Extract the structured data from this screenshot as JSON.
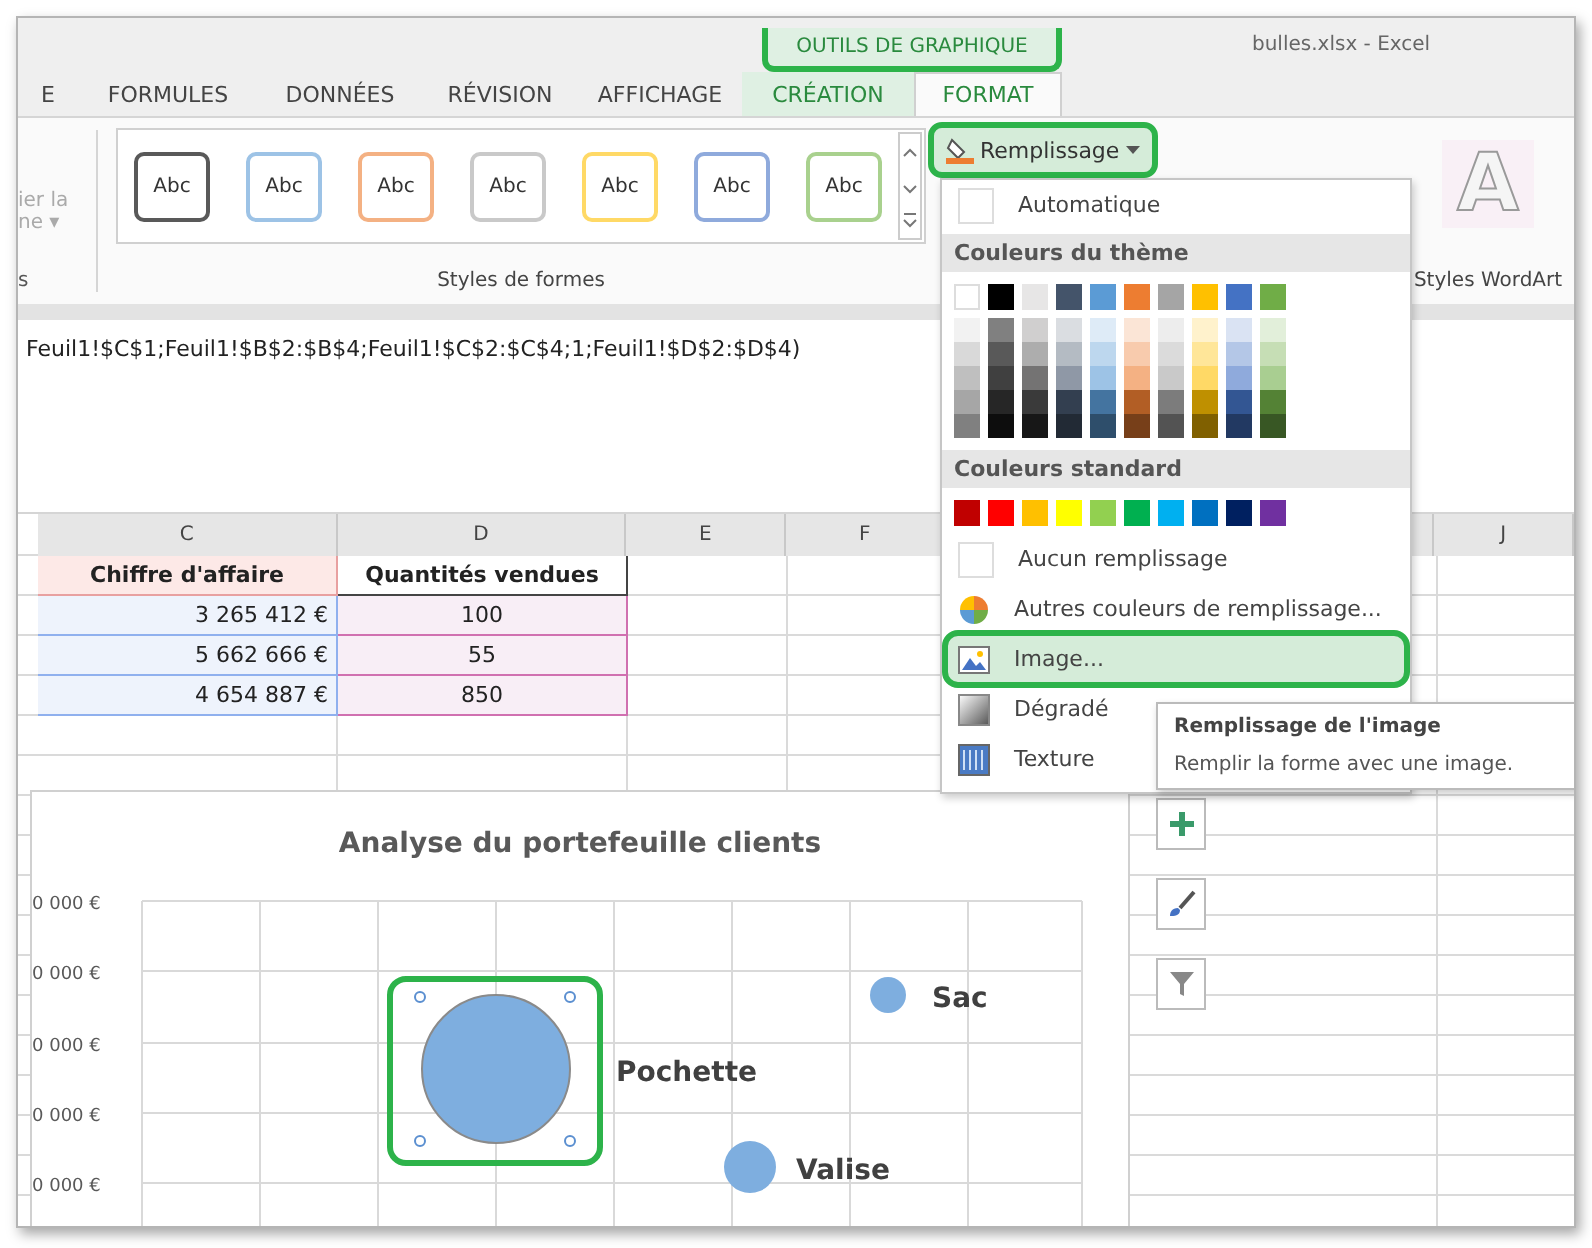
{
  "title_bar": {
    "context_group": {
      "label": "OUTILS DE GRAPHIQUE",
      "highlighted": true
    },
    "title": "bulles.xlsx - Excel"
  },
  "tabs": [
    {
      "label": "E",
      "kind": "normal",
      "selected": false
    },
    {
      "label": "FORMULES",
      "kind": "normal",
      "selected": false
    },
    {
      "label": "DONNÉES",
      "kind": "normal",
      "selected": false
    },
    {
      "label": "RÉVISION",
      "kind": "normal",
      "selected": false
    },
    {
      "label": "AFFICHAGE",
      "kind": "normal",
      "selected": false
    },
    {
      "label": "CRÉATION",
      "kind": "context",
      "selected": false
    },
    {
      "label": "FORMAT",
      "kind": "context",
      "selected": true
    }
  ],
  "ribbon": {
    "left_group": {
      "lines": [
        "ier la",
        "ne ▾"
      ],
      "label": "s",
      "disabled": true
    },
    "shape_styles": {
      "items": [
        {
          "label": "Abc",
          "color": "#595959"
        },
        {
          "label": "Abc",
          "color": "#9dc3e6"
        },
        {
          "label": "Abc",
          "color": "#f4b183"
        },
        {
          "label": "Abc",
          "color": "#c9c9c9"
        },
        {
          "label": "Abc",
          "color": "#ffd966"
        },
        {
          "label": "Abc",
          "color": "#8faadc"
        },
        {
          "label": "Abc",
          "color": "#a9d18e"
        }
      ],
      "label": "Styles de formes"
    },
    "fill_button": {
      "label": "Remplissage",
      "highlighted": true
    },
    "wordart": {
      "letter": "A",
      "label": "Styles WordArt"
    }
  },
  "formula": "Feuil1!$C$1;Feuil1!$B$2:$B$4;Feuil1!$C$2:$C$4;1;Feuil1!$D$2:$D$4)",
  "sheet": {
    "columns": [
      {
        "label": "C"
      },
      {
        "label": "D"
      },
      {
        "label": "E"
      },
      {
        "label": "F"
      },
      {
        "label": "J"
      }
    ],
    "rows": [
      {
        "kind": "header",
        "cells": [
          "Chiffre d'affaire",
          "Quantités vendues"
        ]
      },
      {
        "kind": "data",
        "cells": [
          "3 265 412 €",
          "100"
        ]
      },
      {
        "kind": "data",
        "cells": [
          "5 662 666 €",
          "55"
        ]
      },
      {
        "kind": "data",
        "cells": [
          "4 654 887 €",
          "850"
        ]
      }
    ]
  },
  "fill_menu": {
    "items_top": [
      {
        "label": "Automatique",
        "kind": "blank",
        "selected": false
      }
    ],
    "theme_header": "Couleurs du thème",
    "theme_colors": [
      {
        "color": "#ffffff"
      },
      {
        "color": "#000000"
      },
      {
        "color": "#e7e6e6"
      },
      {
        "color": "#44546a"
      },
      {
        "color": "#5b9bd5"
      },
      {
        "color": "#ed7d31"
      },
      {
        "color": "#a5a5a5"
      },
      {
        "color": "#ffc000"
      },
      {
        "color": "#4472c4"
      },
      {
        "color": "#70ad47"
      }
    ],
    "standard_header": "Couleurs standard",
    "standard_colors": [
      {
        "color": "#c00000"
      },
      {
        "color": "#ff0000"
      },
      {
        "color": "#ffc000"
      },
      {
        "color": "#ffff00"
      },
      {
        "color": "#92d050"
      },
      {
        "color": "#00b050"
      },
      {
        "color": "#00b0f0"
      },
      {
        "color": "#0070c0"
      },
      {
        "color": "#002060"
      },
      {
        "color": "#7030a0"
      }
    ],
    "items": [
      {
        "label": "Aucun remplissage",
        "kind": "blank",
        "selected": false,
        "highlighted": false
      },
      {
        "label": "Autres couleurs de remplissage...",
        "kind": "palette",
        "selected": false,
        "highlighted": false
      },
      {
        "label": "Image...",
        "kind": "picture",
        "selected": true,
        "highlighted": true
      },
      {
        "label": "Dégradé",
        "kind": "gradient",
        "selected": false,
        "highlighted": false
      },
      {
        "label": "Texture",
        "kind": "texture",
        "selected": false,
        "highlighted": false
      }
    ]
  },
  "tooltip": {
    "title": "Remplissage de l'image",
    "text": "Remplir la forme avec une image."
  },
  "chart": {
    "title": "Analyse du portefeuille clients",
    "y_labels": [
      "0 000 €",
      "0 000 €",
      "0 000 €",
      "0 000 €",
      "0 000 €"
    ],
    "bubbles": [
      {
        "label": "Pochette",
        "selected": true,
        "highlighted": true
      },
      {
        "label": "Sac",
        "selected": false,
        "highlighted": false
      },
      {
        "label": "Valise",
        "selected": false,
        "highlighted": false
      }
    ]
  }
}
